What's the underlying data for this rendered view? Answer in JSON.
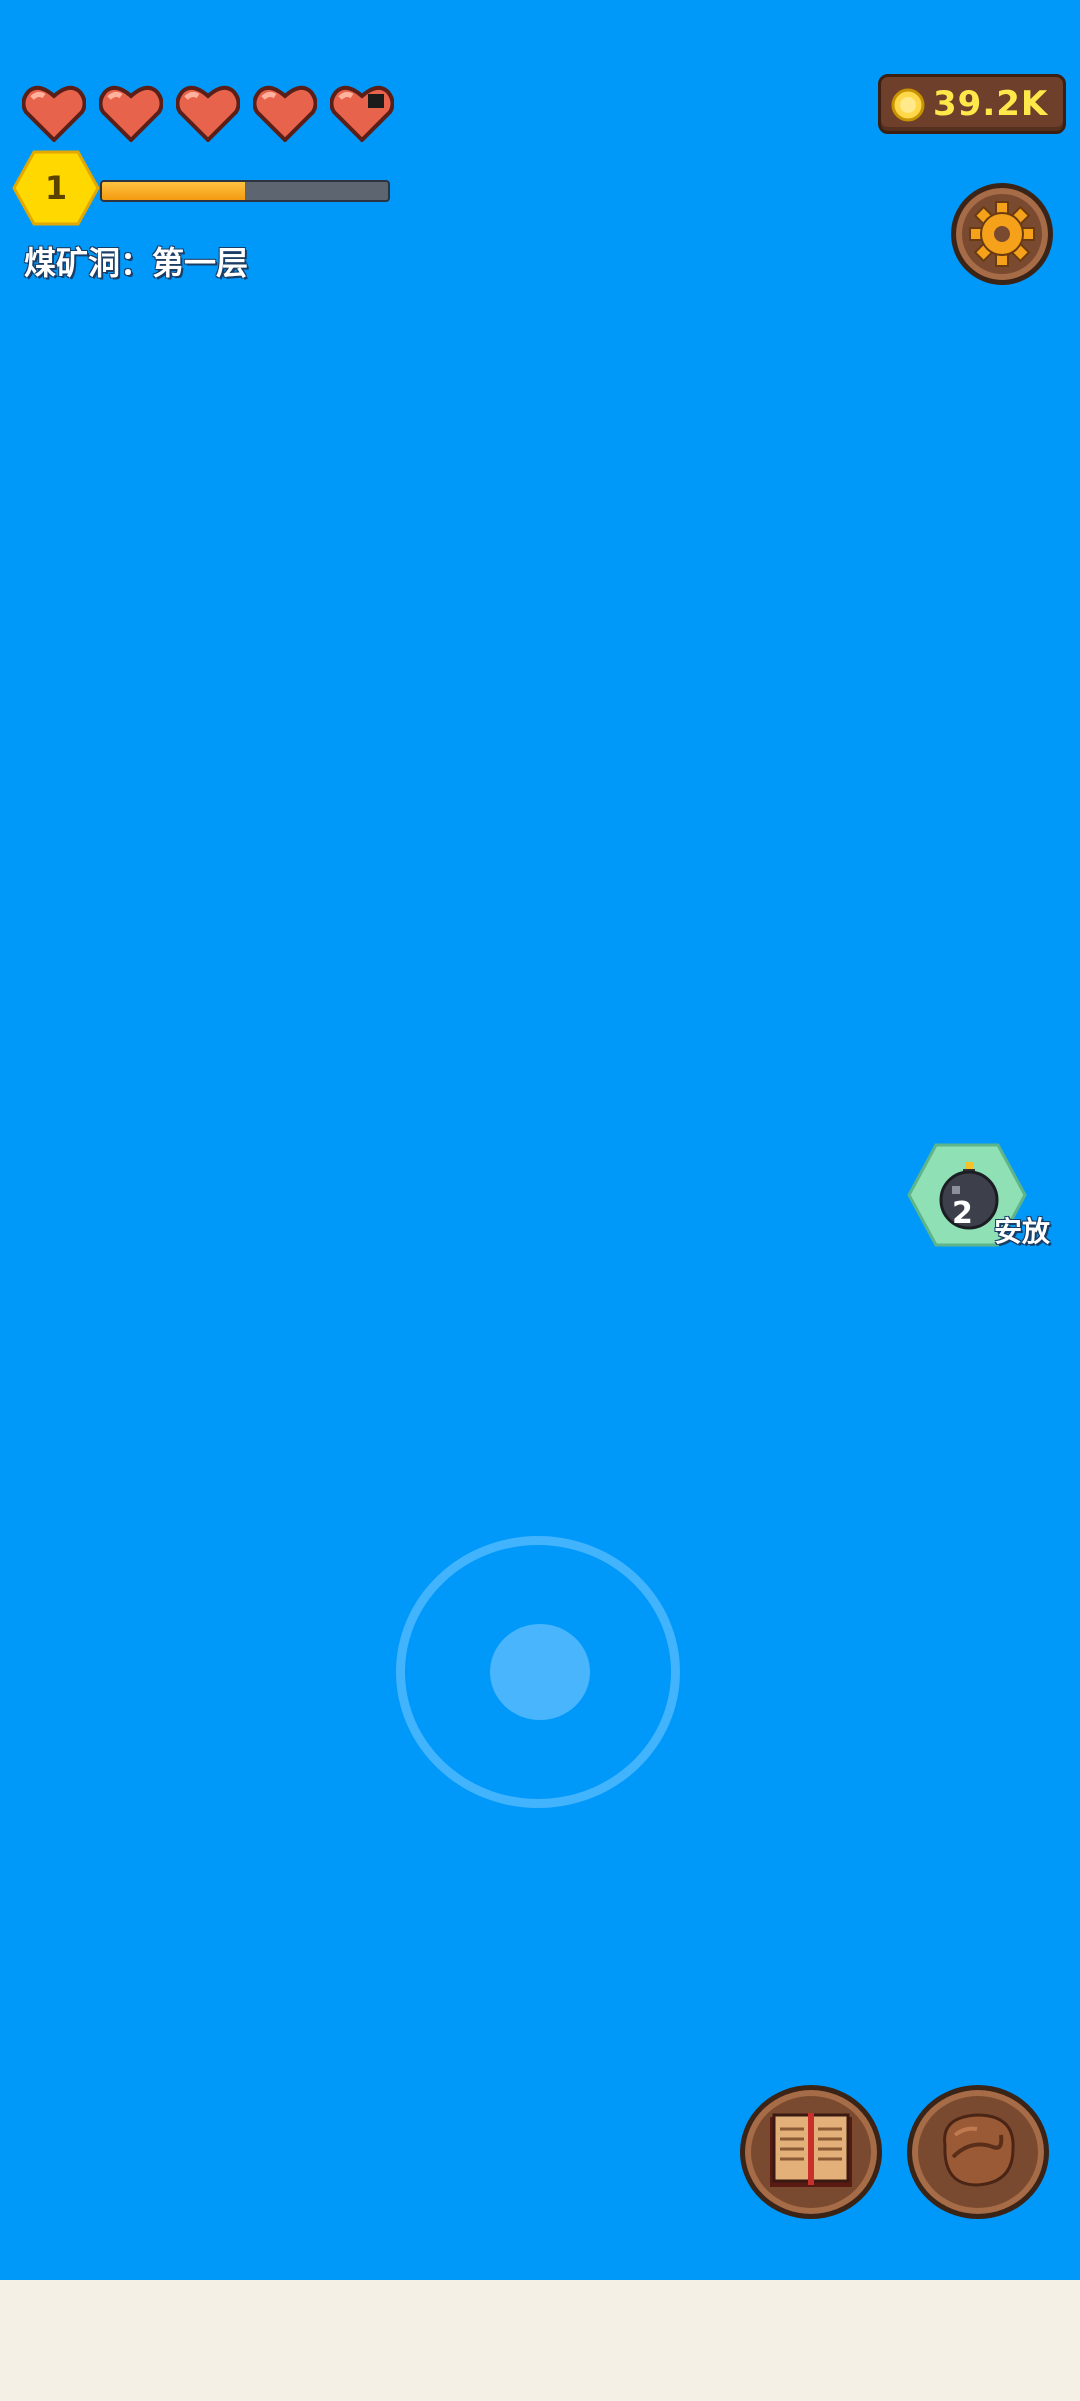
{
  "hud": {
    "hearts": [
      {
        "icon": "heart-full-icon",
        "fill": 1
      },
      {
        "icon": "heart-full-icon",
        "fill": 1
      },
      {
        "icon": "heart-full-icon",
        "fill": 1
      },
      {
        "icon": "heart-full-icon",
        "fill": 1
      },
      {
        "icon": "heart-damaged-icon",
        "fill": 0.9
      }
    ],
    "level": "1",
    "xp_progress": 0.5,
    "location": "煤矿洞：第一层",
    "coins": "39.2K"
  },
  "actions": {
    "bomb_count": "2",
    "bomb_label": "安放"
  },
  "icons": {
    "settings": "gear-icon",
    "book": "book-icon",
    "bag": "bag-icon",
    "coin": "coin-icon",
    "bomb": "bomb-icon"
  },
  "colors": {
    "background": "#0099fa",
    "bottom_bar": "#f5f0e6",
    "xp_fill": "#f7a51c",
    "coin_text": "#ffe84a",
    "level_hex": "#ffd800",
    "bomb_hex": "#8fe0b4"
  }
}
